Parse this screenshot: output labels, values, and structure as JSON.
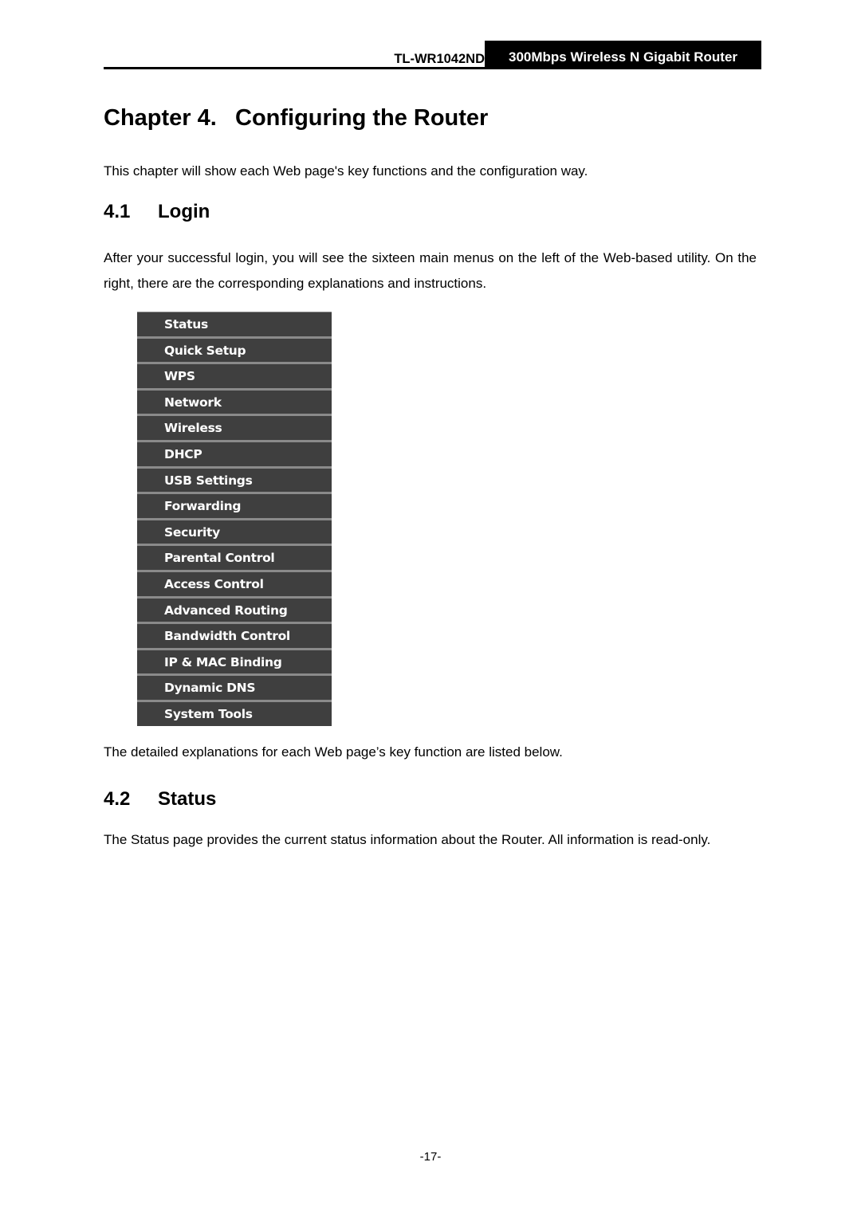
{
  "header": {
    "model": "TL-WR1042ND",
    "product": "300Mbps Wireless N Gigabit Router"
  },
  "chapter": {
    "number": "Chapter 4.",
    "title": "Configuring the Router",
    "intro": "This chapter will show each Web page's key functions and the configuration way."
  },
  "sections": [
    {
      "number": "4.1",
      "title": "Login",
      "text": "After your successful login, you will see the sixteen main menus on the left of the Web-based utility. On the right, there are the corresponding explanations and instructions.",
      "after_menu_text": "The detailed explanations for each Web page’s key function are listed below."
    },
    {
      "number": "4.2",
      "title": "Status",
      "text": "The Status page provides the current status information about the Router. All information is read-only."
    }
  ],
  "menu": {
    "items": [
      {
        "label": "Status"
      },
      {
        "label": "Quick Setup"
      },
      {
        "label": "WPS"
      },
      {
        "label": "Network"
      },
      {
        "label": "Wireless"
      },
      {
        "label": "DHCP"
      },
      {
        "label": "USB Settings"
      },
      {
        "label": "Forwarding"
      },
      {
        "label": "Security"
      },
      {
        "label": "Parental Control"
      },
      {
        "label": "Access Control"
      },
      {
        "label": "Advanced Routing"
      },
      {
        "label": "Bandwidth Control"
      },
      {
        "label": "IP & MAC Binding"
      },
      {
        "label": "Dynamic DNS"
      },
      {
        "label": "System Tools"
      }
    ]
  },
  "footer": {
    "page_number": "-17-"
  }
}
